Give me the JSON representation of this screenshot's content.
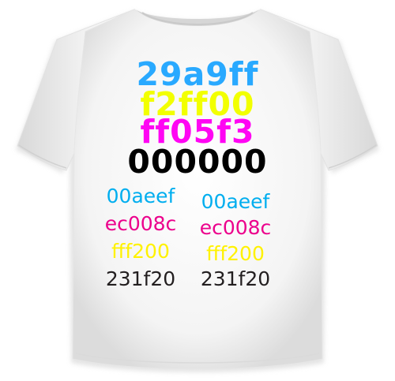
{
  "shirt": {
    "fabric_color": "#ffffff",
    "shadow_color": "#d4d4d4"
  },
  "top_lines": [
    {
      "text": "29a9ff",
      "color": "#29a9ff"
    },
    {
      "text": "f2ff00",
      "color": "#f2ff00"
    },
    {
      "text": "ff05f3",
      "color": "#ff05f3"
    },
    {
      "text": "000000",
      "color": "#000000"
    }
  ],
  "left_column": [
    {
      "text": "00aeef",
      "color": "#00aeef"
    },
    {
      "text": "ec008c",
      "color": "#ec008c"
    },
    {
      "text": "fff200",
      "color": "#fff200"
    },
    {
      "text": "231f20",
      "color": "#231f20"
    }
  ],
  "right_column": [
    {
      "text": "00aeef",
      "color": "#00aeef"
    },
    {
      "text": "ec008c",
      "color": "#ec008c"
    },
    {
      "text": "fff200",
      "color": "#fff200"
    },
    {
      "text": "231f20",
      "color": "#231f20"
    }
  ]
}
